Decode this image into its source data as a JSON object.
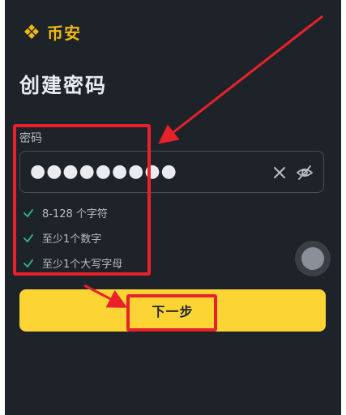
{
  "app": {
    "brand_name": "币安"
  },
  "page": {
    "title": "创建密码"
  },
  "password_field": {
    "label": "密码",
    "masked_value": "●●●●●●●●●"
  },
  "rules": [
    {
      "text": "8-128 个字符",
      "met": true
    },
    {
      "text": "至少1个数字",
      "met": true
    },
    {
      "text": "至少1个大写字母",
      "met": true
    }
  ],
  "actions": {
    "next_label": "下一步"
  },
  "colors": {
    "background": "#1e2329",
    "brand": "#f0b90b",
    "primary_button": "#fcd535",
    "check": "#2ebd85",
    "annotation": "#e8212b"
  },
  "icons": {
    "logo": "binance-logo-icon",
    "clear": "clear-icon",
    "visibility": "eye-off-icon",
    "rule_check": "check-icon"
  }
}
